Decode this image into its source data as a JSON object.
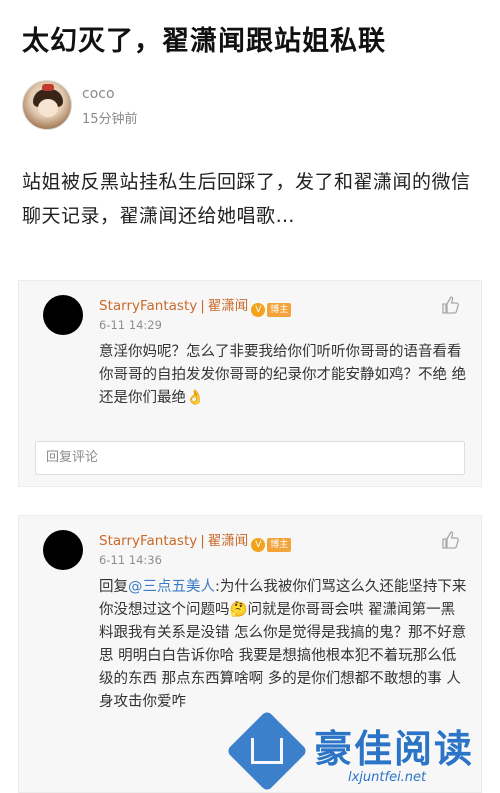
{
  "article": {
    "title": "太幻灭了，翟潇闻跟站姐私联",
    "author_name": "coco",
    "post_time": "15分钟前",
    "body": "站姐被反黑站挂私生后回踩了，发了和翟潇闻的微信聊天记录，翟潇闻还给她唱歌…"
  },
  "comments": [
    {
      "username": "StarryFantasty",
      "tag": "翟潇闻",
      "badge_v": "V",
      "badge_blogger": "博主",
      "time": "6-11 14:29",
      "text": "意淫你妈呢？怎么了非要我给你们听听你哥哥的语音看看你哥哥的自拍发发你哥哥的纪录你才能安静如鸡？不绝 绝还是你们最绝👌",
      "reply_placeholder": "回复评论"
    },
    {
      "username": "StarryFantasty",
      "tag": "翟潇闻",
      "badge_v": "V",
      "badge_blogger": "博主",
      "time": "6-11 14:36",
      "reply_prefix": "回复",
      "mention": "@三点五美人",
      "text": ":为什么我被你们骂这么久还能坚持下来 你没想过这个问题吗🤔问就是你哥哥会哄 翟潇闻第一黑料跟我有关系是没错 怎么你是觉得是我搞的鬼？那不好意思 明明白白告诉你哈 我要是想搞他根本犯不着玩那么低级的东西 那点东西算啥啊 多的是你们想都不敢想的事 人身攻击你爱咋"
    }
  ],
  "watermark": {
    "brand": "豪佳阅读",
    "url": "lxjuntfei.net"
  },
  "colors": {
    "username": "#c86a2a",
    "mention": "#3b7cc4",
    "watermark": "#2b74c6"
  }
}
